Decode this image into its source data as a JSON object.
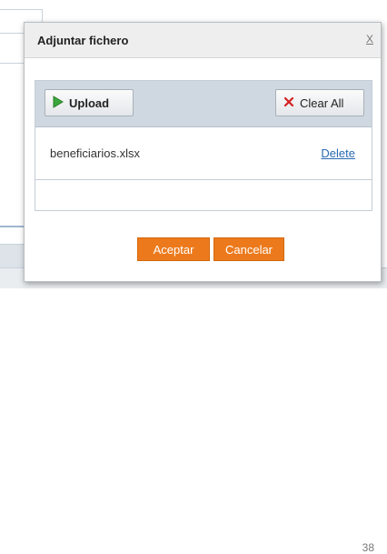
{
  "background": {
    "page_number": "38"
  },
  "dialog": {
    "title": "Adjuntar fichero",
    "close_label": "X",
    "toolbar": {
      "upload_label": "Upload",
      "clear_label": "Clear All"
    },
    "files": [
      {
        "name": "beneficiarios.xlsx",
        "delete_label": "Delete"
      }
    ],
    "buttons": {
      "accept": "Aceptar",
      "cancel": "Cancelar"
    }
  },
  "colors": {
    "accent": "#ec7a1c",
    "link": "#2a6bb2",
    "toolbar": "#cfd8e0",
    "upload_icon": "#3aa63a",
    "clear_icon": "#d42020"
  },
  "icons": {
    "upload": "play-arrow-icon",
    "clear": "x-icon"
  }
}
